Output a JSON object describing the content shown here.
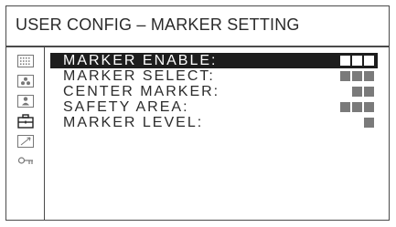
{
  "header": {
    "title": "USER CONFIG – MARKER SETTING"
  },
  "sidebar": {
    "icons": [
      "grid-dots-icon",
      "three-circles-icon",
      "person-icon",
      "toolbox-icon",
      "arrow-icon",
      "key-icon"
    ],
    "selected_index": 3
  },
  "menu": {
    "items": [
      {
        "label": "MARKER ENABLE:",
        "value_blocks": 3,
        "selected": true
      },
      {
        "label": "MARKER SELECT:",
        "value_blocks": 3,
        "selected": false
      },
      {
        "label": "CENTER MARKER:",
        "value_blocks": 2,
        "selected": false
      },
      {
        "label": "SAFETY AREA:",
        "value_blocks": 3,
        "selected": false
      },
      {
        "label": "MARKER LEVEL:",
        "value_blocks": 1,
        "selected": false
      }
    ]
  }
}
